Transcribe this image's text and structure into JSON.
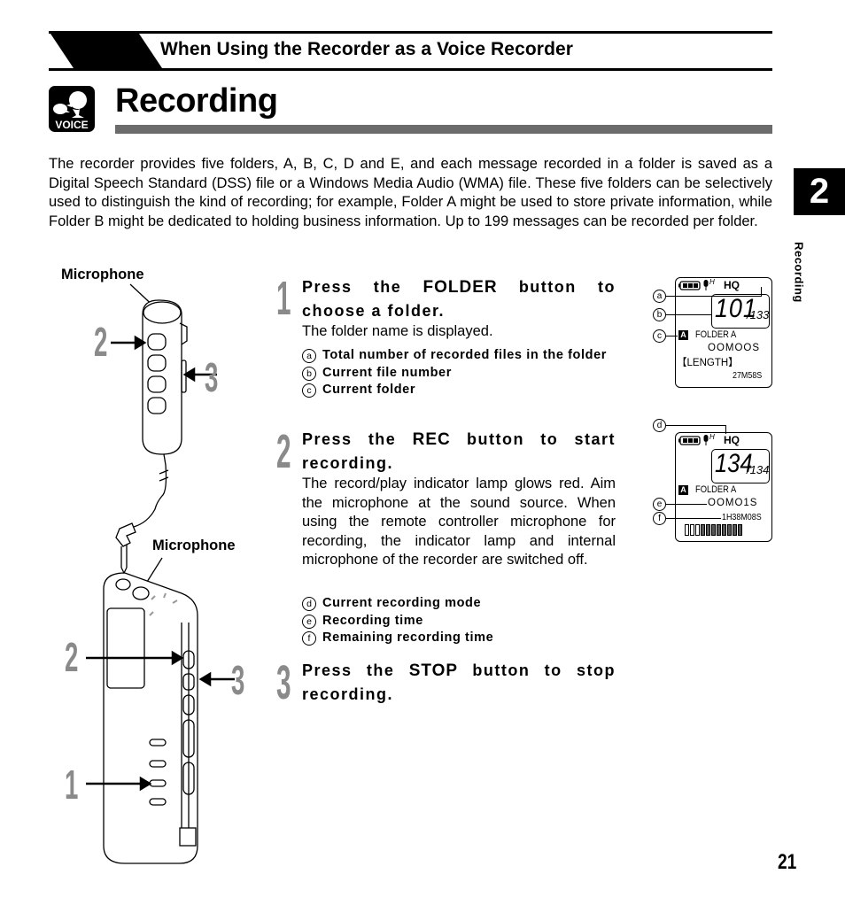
{
  "header": {
    "section_title": "When Using the Recorder as a Voice Recorder"
  },
  "title": {
    "icon": "voice-icon",
    "icon_text": "VOICE",
    "text": "Recording"
  },
  "chapter_tab": {
    "number": "2",
    "label": "Recording"
  },
  "intro": "The recorder provides five folders, A, B, C, D and E, and each message recorded in a folder is saved as a Digital Speech Standard (DSS) file or a Windows Media Audio (WMA) file. These five folders can be selectively used to distinguish the kind of recording; for example, Folder A might be used to store private information, while Folder B might be dedicated to holding business information. Up to 199 messages can be recorded per folder.",
  "steps": [
    {
      "number": "1",
      "head_pre": "Press the ",
      "keyword": "FOLDER",
      "head_post": " button to choose a folder.",
      "body": "The folder name is displayed.",
      "legend": [
        {
          "mark": "a",
          "text": "Total number of recorded files in the folder"
        },
        {
          "mark": "b",
          "text": "Current file number"
        },
        {
          "mark": "c",
          "text": "Current folder"
        }
      ]
    },
    {
      "number": "2",
      "head_pre": "Press the ",
      "keyword": "REC",
      "head_post": " button to start recording.",
      "body": "The record/play indicator lamp glows red. Aim the microphone at the sound source. When using the remote controller microphone for recording, the indicator lamp and internal microphone of the recorder are switched off.",
      "legend": [
        {
          "mark": "d",
          "text": "Current recording mode"
        },
        {
          "mark": "e",
          "text": "Recording time"
        },
        {
          "mark": "f",
          "text": "Remaining recording time"
        }
      ]
    },
    {
      "number": "3",
      "head_pre": "Press the ",
      "keyword": "STOP",
      "head_post": " button to stop recording."
    }
  ],
  "lcd1": {
    "mic_sens": "H",
    "mode": "HQ",
    "current": "101",
    "total": "/133",
    "folder_icon": "A",
    "folder": "FOLDER A",
    "time": "OOMOOS",
    "length_label": "【LENGTH】",
    "length": "27M58S",
    "callouts": [
      "a",
      "b",
      "c"
    ]
  },
  "lcd2": {
    "mic_sens": "H",
    "mode": "HQ",
    "current": "134",
    "total": "/134",
    "folder_icon": "A",
    "folder": "FOLDER A",
    "time": "OOMO1S",
    "remaining": "1H38M08S",
    "level_meter": 0.7,
    "callouts": [
      "d",
      "e",
      "f"
    ]
  },
  "illustration": {
    "remote_mic_label": "Microphone",
    "recorder_mic_label": "Microphone",
    "remote_arrows": [
      "2",
      "3"
    ],
    "recorder_arrows": [
      "2",
      "3",
      "1"
    ]
  },
  "page_number": "21"
}
